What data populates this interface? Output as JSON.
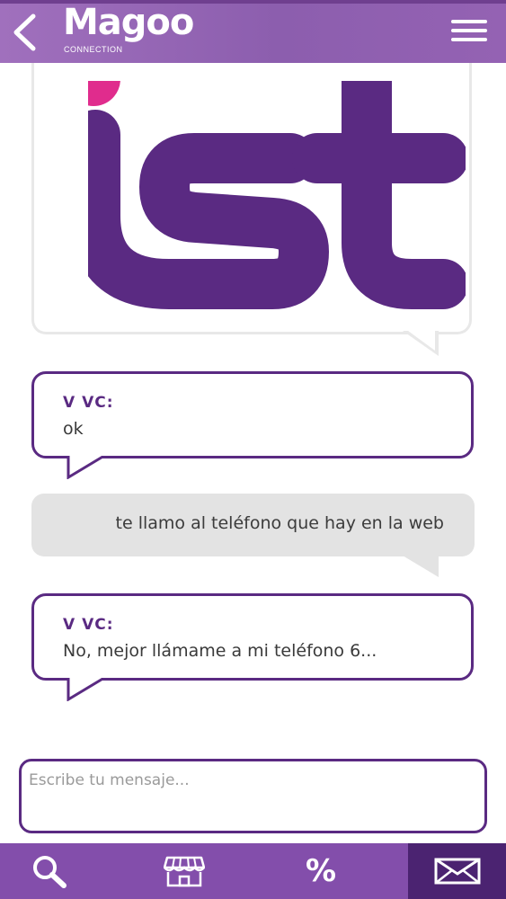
{
  "header": {
    "logo_word": "Magoo",
    "logo_sub": "CONNECTION"
  },
  "shared_image": {
    "logo_text": "ist"
  },
  "messages": [
    {
      "direction": "in",
      "sender": "V VC:",
      "text": "ok"
    },
    {
      "direction": "out",
      "text": "te llamo al teléfono que hay en la web"
    },
    {
      "direction": "in",
      "sender": "V VC:",
      "text": "No, mejor llámame a mi teléfono 6..."
    }
  ],
  "compose": {
    "placeholder": "Escribe tu mensaje...",
    "value": ""
  },
  "tabs": [
    {
      "icon": "search-icon"
    },
    {
      "icon": "store-icon"
    },
    {
      "icon": "percent-icon",
      "label": "%"
    },
    {
      "icon": "mail-icon",
      "active": true
    }
  ],
  "colors": {
    "brand_purple": "#5a2a82",
    "header_purple": "#9462b3",
    "tabbar_purple": "#834eab",
    "active_tab": "#4b2371",
    "logo_dot_pink": "#e02c8d",
    "outgoing_bubble": "#e3e3e3"
  }
}
